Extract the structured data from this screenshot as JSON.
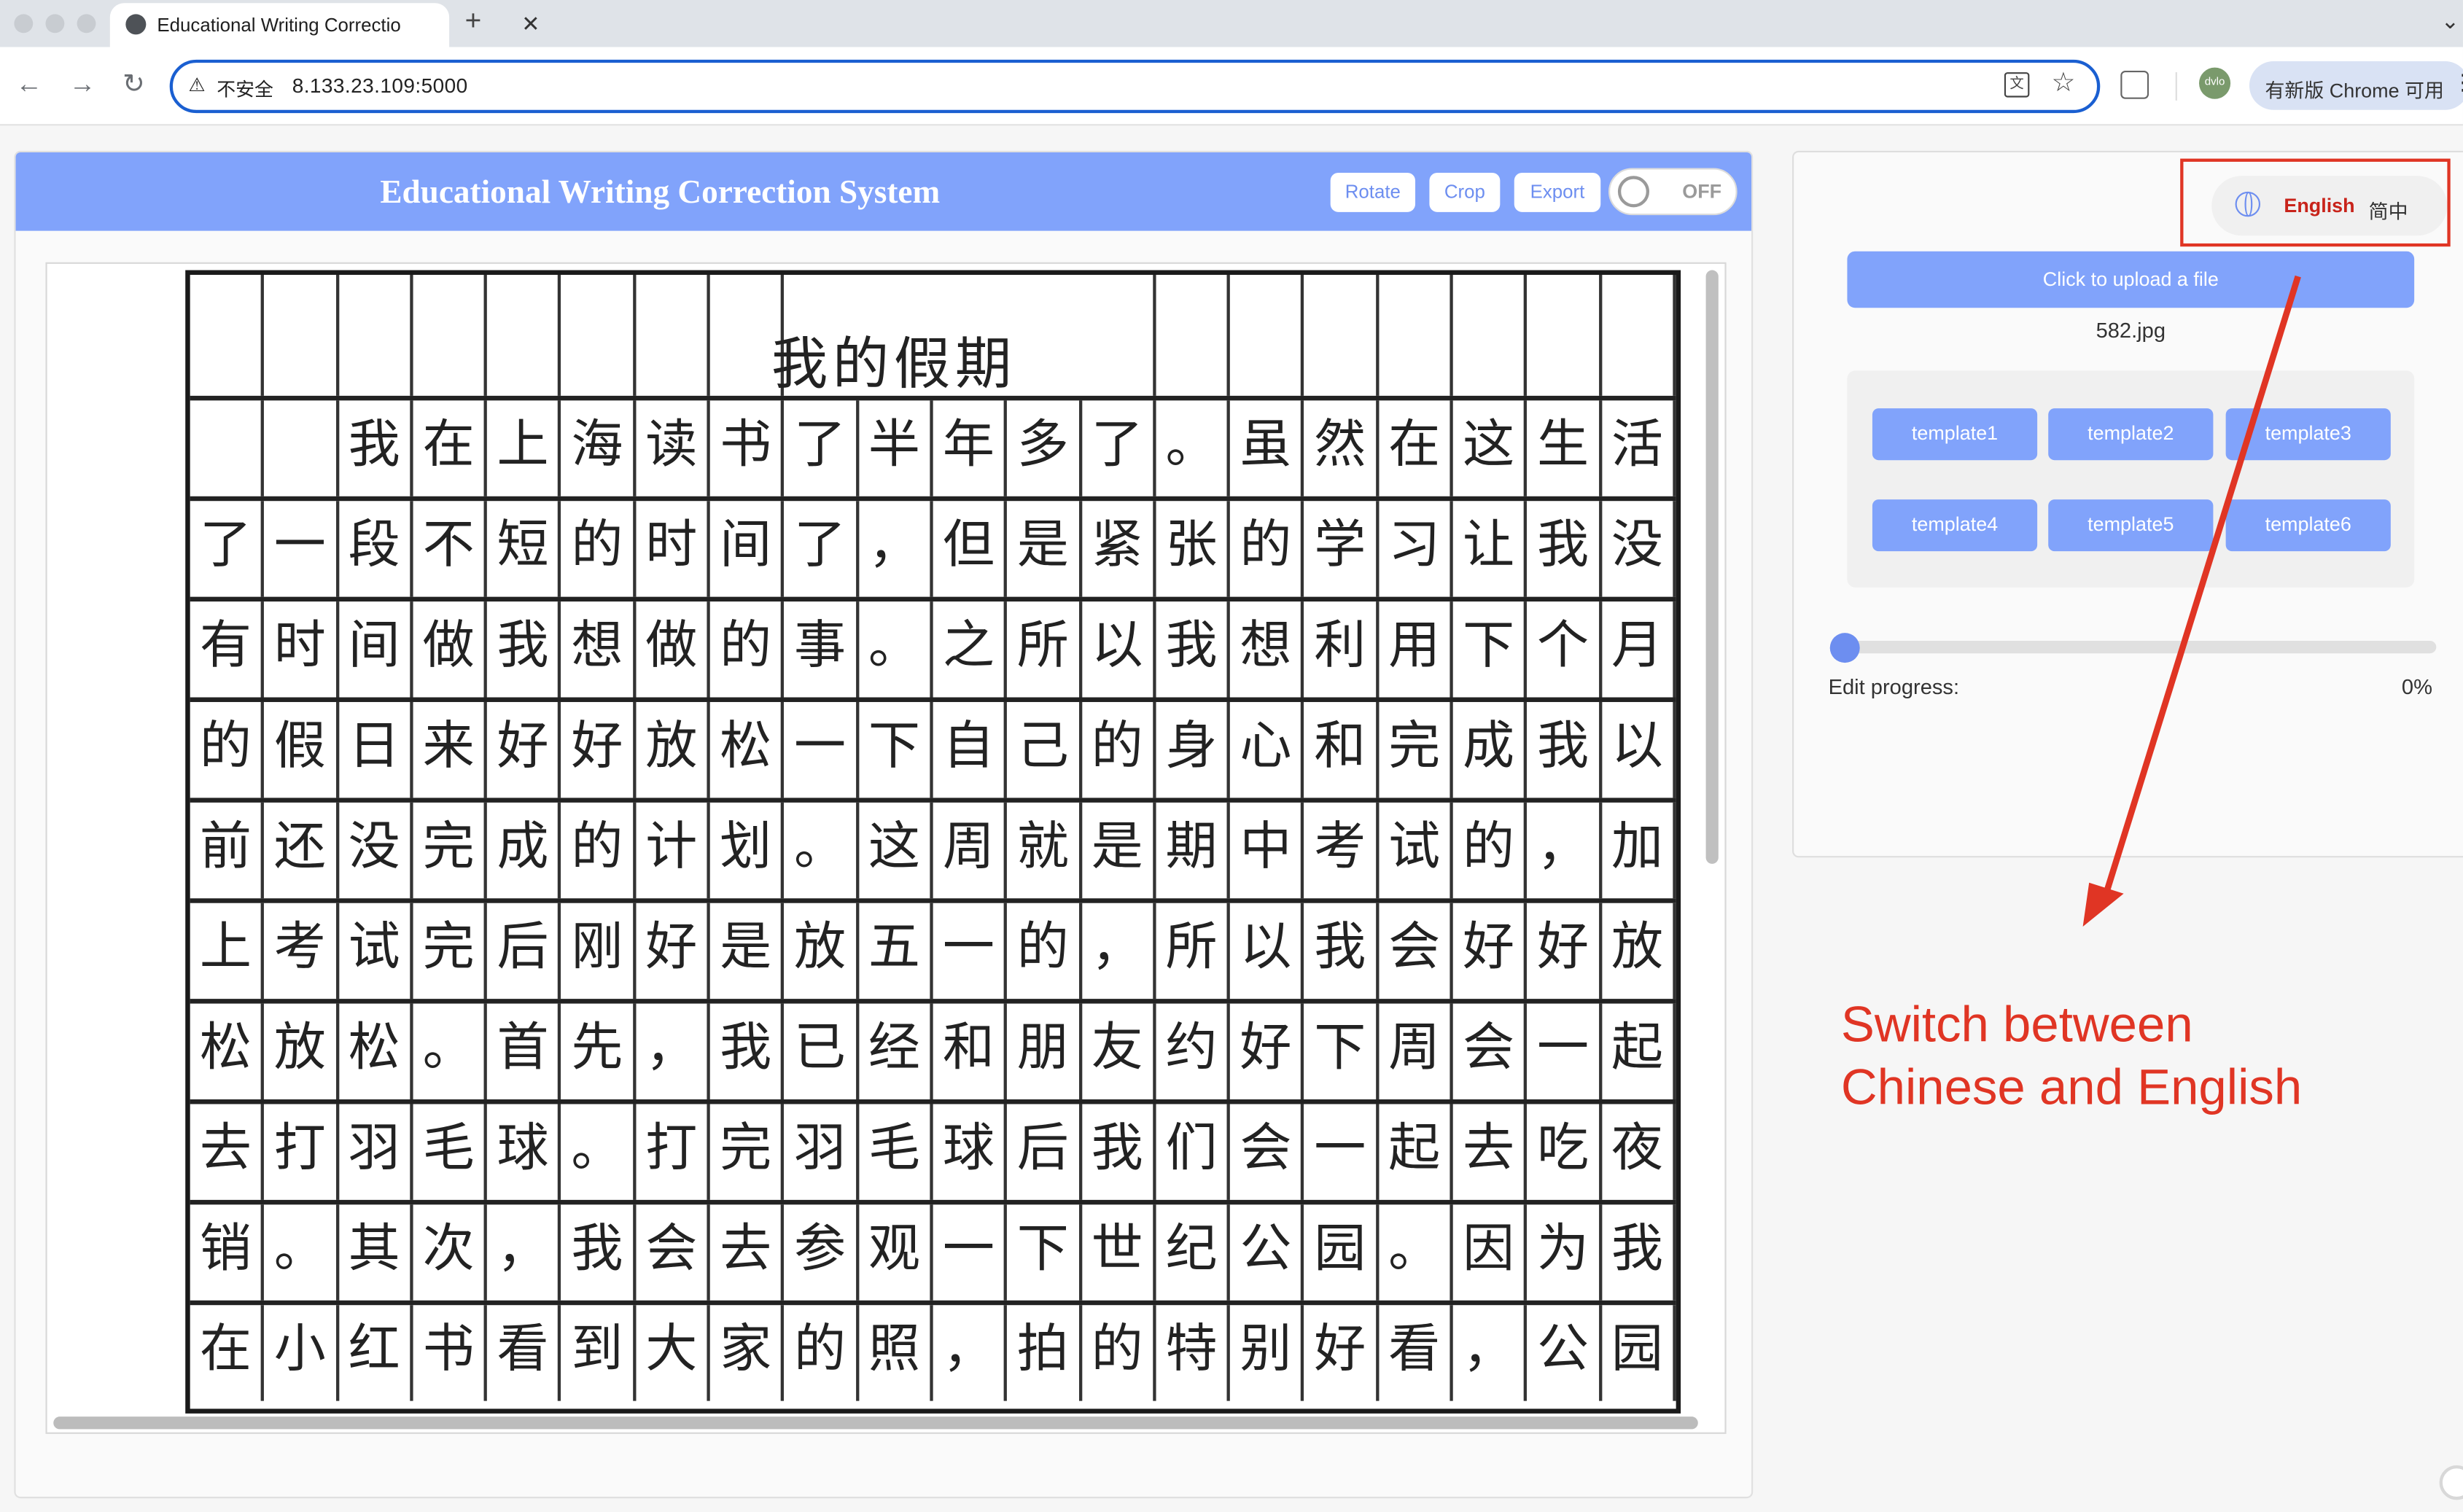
{
  "browser": {
    "tab_title": "Educational Writing Correctio",
    "close_glyph": "✕",
    "new_tab_glyph": "+",
    "insecure_label": "不安全",
    "url": "8.133.23.109:5000",
    "update_label": "有新版 Chrome 可用",
    "profile_initials": "dvlo"
  },
  "app": {
    "title": "Educational Writing Correction System",
    "buttons": {
      "rotate": "Rotate",
      "crop": "Crop",
      "export": "Export"
    },
    "toggle_label": "OFF",
    "accent_color": "#81a3fb"
  },
  "essay": {
    "title": "我的假期",
    "rows": [
      "  我在上海读书了半年多了。虽然在这生活",
      "了一段不短的时间了，但是紧张的学习让我没",
      "有时间做我想做的事。之所以我想利用下个月",
      "的假日来好好放松一下自己的身心和完成我以",
      "前还没完成的计划。这周就是期中考试的，加",
      "上考试完后刚好是放五一的，所以我会好好放",
      "松放松。首先，我已经和朋友约好下周会一起",
      "去打羽毛球。打完羽毛球后我们会一起去吃夜",
      "销。其次，我会去参观一下世纪公园。因为我",
      "在小红书看到大家的照，拍的特别好看，公园"
    ]
  },
  "sidebar": {
    "language": {
      "english": "English",
      "chinese": "简中"
    },
    "upload_label": "Click to upload a file",
    "filename": "582.jpg",
    "templates": [
      "template1",
      "template2",
      "template3",
      "template4",
      "template5",
      "template6"
    ],
    "progress_label": "Edit progress:",
    "progress_value": "0%",
    "progress_fraction": 0
  },
  "annotation": {
    "line1": "Switch between",
    "line2": "Chinese and English",
    "color": "#e03524"
  }
}
